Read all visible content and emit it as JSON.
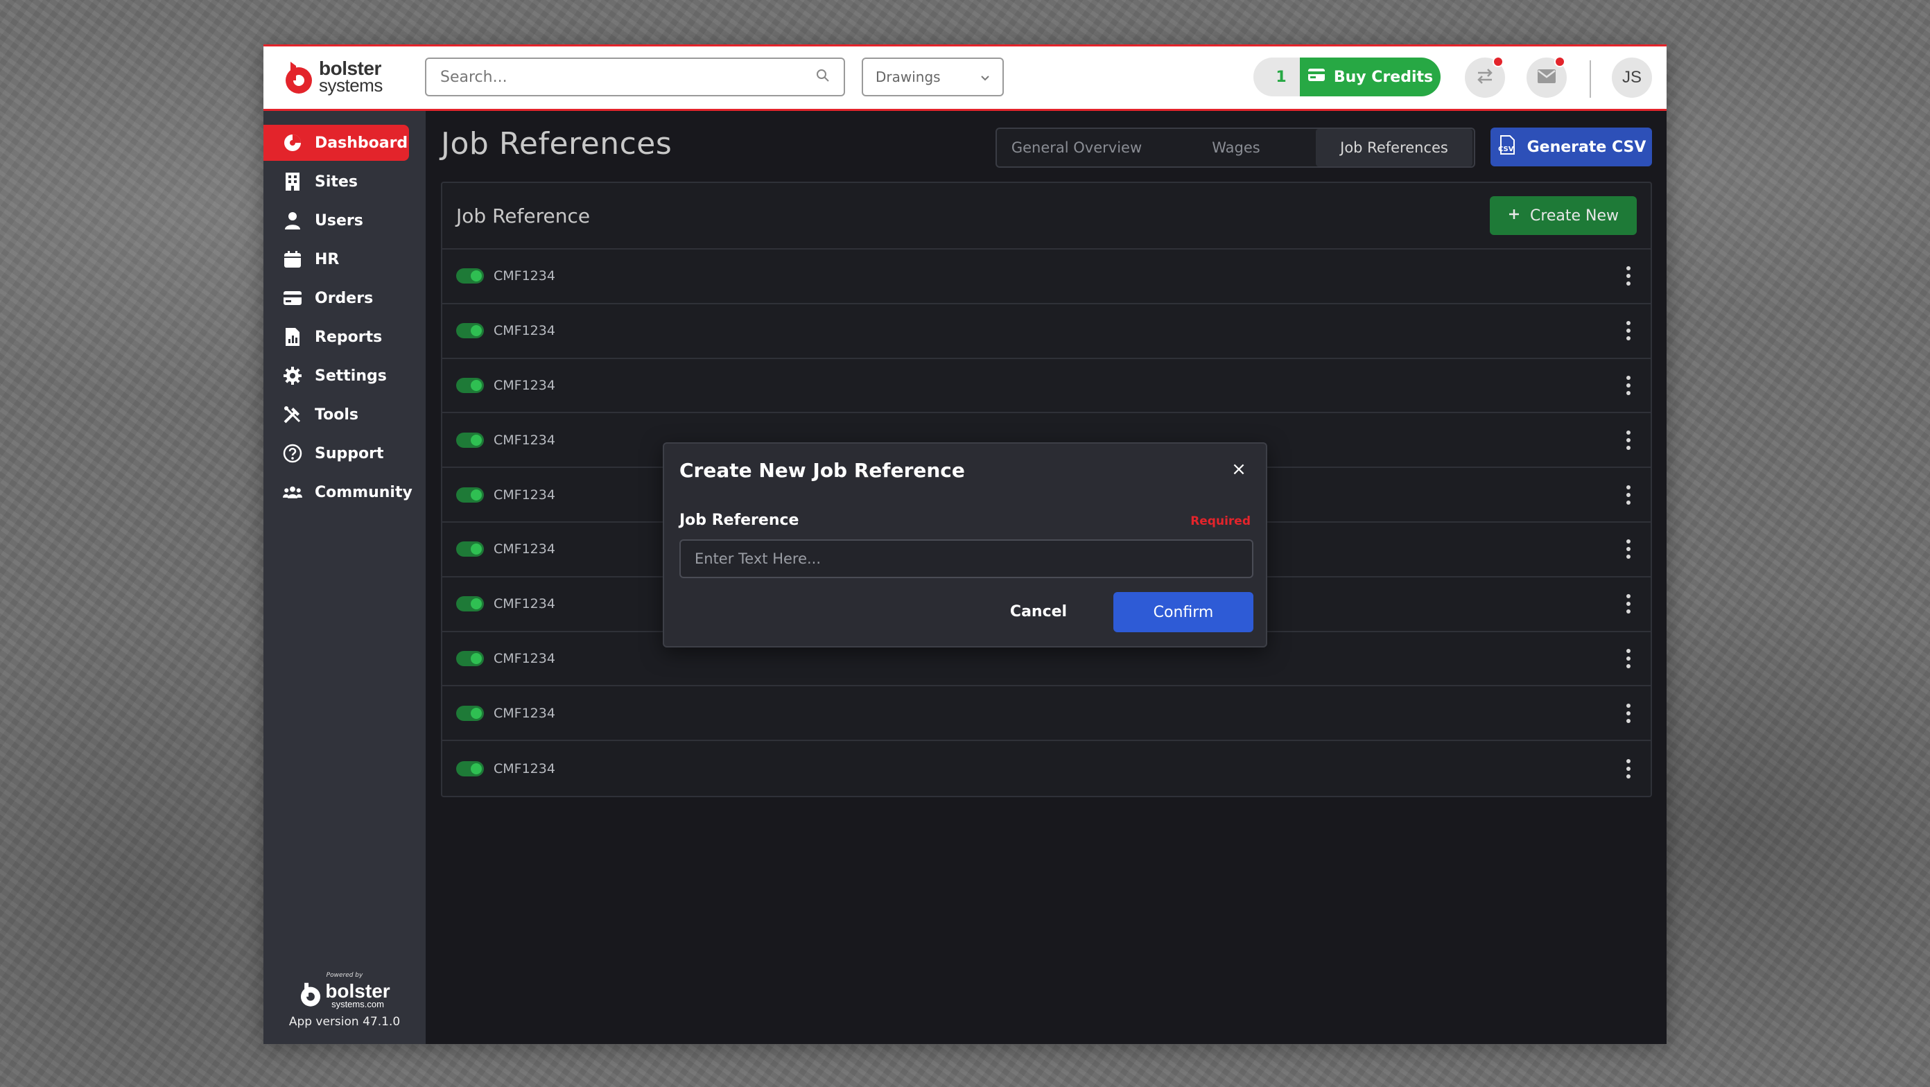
{
  "brand": {
    "name_line1": "bolster",
    "name_line2": "systems",
    "accent": "#e3242b"
  },
  "header": {
    "search_placeholder": "Search...",
    "dropdown_value": "Drawings",
    "credits_count": "1",
    "buy_credits_label": "Buy Credits",
    "avatar_initials": "JS"
  },
  "sidebar": {
    "items": [
      {
        "label": "Dashboard",
        "icon": "pie-chart-icon",
        "active": true
      },
      {
        "label": "Sites",
        "icon": "building-icon"
      },
      {
        "label": "Users",
        "icon": "user-icon"
      },
      {
        "label": "HR",
        "icon": "calendar-icon"
      },
      {
        "label": "Orders",
        "icon": "credit-card-icon"
      },
      {
        "label": "Reports",
        "icon": "report-icon"
      },
      {
        "label": "Settings",
        "icon": "gear-icon"
      },
      {
        "label": "Tools",
        "icon": "tools-icon"
      },
      {
        "label": "Support",
        "icon": "help-icon"
      },
      {
        "label": "Community",
        "icon": "community-icon"
      }
    ],
    "footer": {
      "powered_by": "Powered by",
      "logo_line1": "bolster",
      "logo_line2": "systems.com",
      "version": "App version 47.1.0"
    }
  },
  "main": {
    "title": "Job References",
    "tabs": [
      {
        "label": "General Overview"
      },
      {
        "label": "Wages"
      },
      {
        "label": "Job References",
        "active": true
      }
    ],
    "generate_csv_label": "Generate CSV",
    "panel": {
      "title": "Job Reference",
      "create_new_label": "Create New",
      "rows": [
        "CMF1234",
        "CMF1234",
        "CMF1234",
        "CMF1234",
        "CMF1234",
        "CMF1234",
        "CMF1234",
        "CMF1234",
        "CMF1234",
        "CMF1234"
      ]
    }
  },
  "modal": {
    "title": "Create New Job Reference",
    "close_symbol": "×",
    "field_label": "Job Reference",
    "required_label": "Required",
    "input_placeholder": "Enter Text Here...",
    "cancel_label": "Cancel",
    "confirm_label": "Confirm"
  },
  "colors": {
    "sidebar_bg": "#31333b",
    "content_bg": "#18181d",
    "success_green": "#27a844",
    "primary_blue": "#2e5bd6"
  }
}
